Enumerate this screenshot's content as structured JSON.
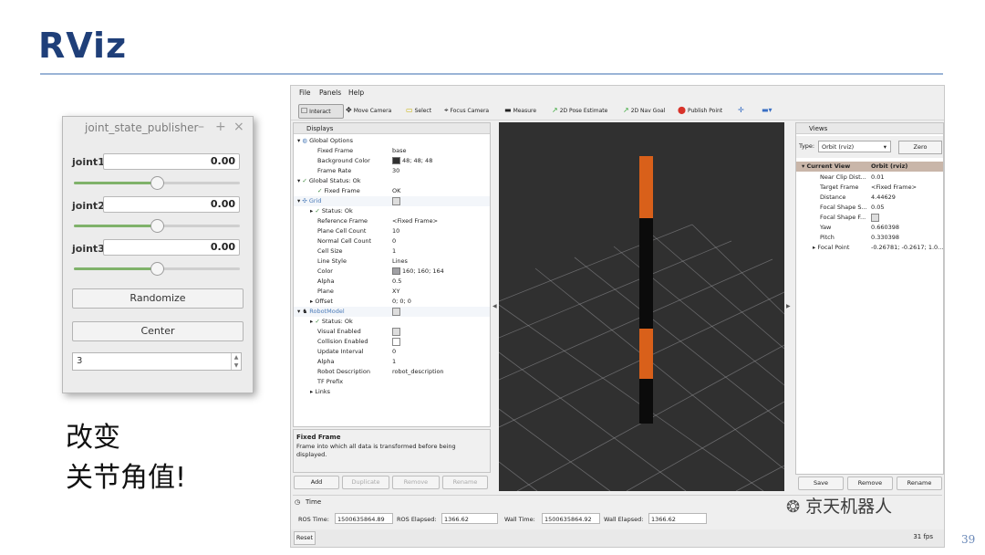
{
  "slide": {
    "title": "RViz",
    "page_number": "39"
  },
  "joint_state_publisher": {
    "title": "joint_state_publisher",
    "controls": [
      "–",
      "+",
      "×"
    ],
    "joints": [
      {
        "label": "joint1",
        "value": "0.00",
        "slider_fraction": 0.5
      },
      {
        "label": "joint2",
        "value": "0.00",
        "slider_fraction": 0.5
      },
      {
        "label": "joint3",
        "value": "0.00",
        "slider_fraction": 0.5
      }
    ],
    "randomize_label": "Randomize",
    "center_label": "Center",
    "count_value": "3"
  },
  "caption": {
    "line1": "改变",
    "line2": "关节角值!"
  },
  "rviz": {
    "menu": [
      "File",
      "Panels",
      "Help"
    ],
    "toolbar": [
      "Interact",
      "Move Camera",
      "Select",
      "Focus Camera",
      "Measure",
      "2D Pose Estimate",
      "2D Nav Goal",
      "Publish Point"
    ],
    "displays": {
      "title": "Displays",
      "rows": [
        {
          "name": "Global Options",
          "value": ""
        },
        {
          "name": "Fixed Frame",
          "value": "base"
        },
        {
          "name": "Background Color",
          "value": "48; 48; 48"
        },
        {
          "name": "Frame Rate",
          "value": "30"
        },
        {
          "name": "Global Status: Ok",
          "value": ""
        },
        {
          "name": "Fixed Frame",
          "value": "OK"
        },
        {
          "name": "Grid",
          "value": ""
        },
        {
          "name": "Status: Ok",
          "value": ""
        },
        {
          "name": "Reference Frame",
          "value": "<Fixed Frame>"
        },
        {
          "name": "Plane Cell Count",
          "value": "10"
        },
        {
          "name": "Normal Cell Count",
          "value": "0"
        },
        {
          "name": "Cell Size",
          "value": "1"
        },
        {
          "name": "Line Style",
          "value": "Lines"
        },
        {
          "name": "Color",
          "value": "160; 160; 164"
        },
        {
          "name": "Alpha",
          "value": "0.5"
        },
        {
          "name": "Plane",
          "value": "XY"
        },
        {
          "name": "Offset",
          "value": "0; 0; 0"
        },
        {
          "name": "RobotModel",
          "value": ""
        },
        {
          "name": "Status: Ok",
          "value": ""
        },
        {
          "name": "Visual Enabled",
          "value": ""
        },
        {
          "name": "Collision Enabled",
          "value": ""
        },
        {
          "name": "Update Interval",
          "value": "0"
        },
        {
          "name": "Alpha",
          "value": "1"
        },
        {
          "name": "Robot Description",
          "value": "robot_description"
        },
        {
          "name": "TF Prefix",
          "value": ""
        },
        {
          "name": "Links",
          "value": ""
        }
      ],
      "description_title": "Fixed Frame",
      "description_text": "Frame into which all data is transformed before being displayed.",
      "buttons": [
        "Add",
        "Duplicate",
        "Remove",
        "Rename"
      ]
    },
    "views": {
      "title": "Views",
      "type_label": "Type:",
      "type_value": "Orbit (rviz)",
      "zero_label": "Zero",
      "header": {
        "name": "Current View",
        "value": "Orbit (rviz)"
      },
      "rows": [
        {
          "name": "Near Clip Dist...",
          "value": "0.01"
        },
        {
          "name": "Target Frame",
          "value": "<Fixed Frame>"
        },
        {
          "name": "Distance",
          "value": "4.44629"
        },
        {
          "name": "Focal Shape S...",
          "value": "0.05"
        },
        {
          "name": "Focal Shape F...",
          "value": ""
        },
        {
          "name": "Yaw",
          "value": "0.660398"
        },
        {
          "name": "Pitch",
          "value": "0.330398"
        },
        {
          "name": "Focal Point",
          "value": "-0.26781; -0.2617; 1.0..."
        }
      ],
      "buttons": [
        "Save",
        "Remove",
        "Rename"
      ]
    },
    "time": {
      "title": "Time",
      "ros_time_label": "ROS Time:",
      "ros_time": "1500635864.89",
      "ros_elapsed_label": "ROS Elapsed:",
      "ros_elapsed": "1366.62",
      "wall_time_label": "Wall Time:",
      "wall_time": "1500635864.92",
      "wall_elapsed_label": "Wall Elapsed:",
      "wall_elapsed": "1366.62"
    },
    "reset_label": "Reset",
    "fps": "31 fps"
  },
  "watermark": "京天机器人",
  "colors": {
    "title_blue": "#1f3f79",
    "robot_orange": "#d9601a",
    "robot_black": "#0b0b0b",
    "viewport": "#303030",
    "grid": "#a0a0a4"
  }
}
